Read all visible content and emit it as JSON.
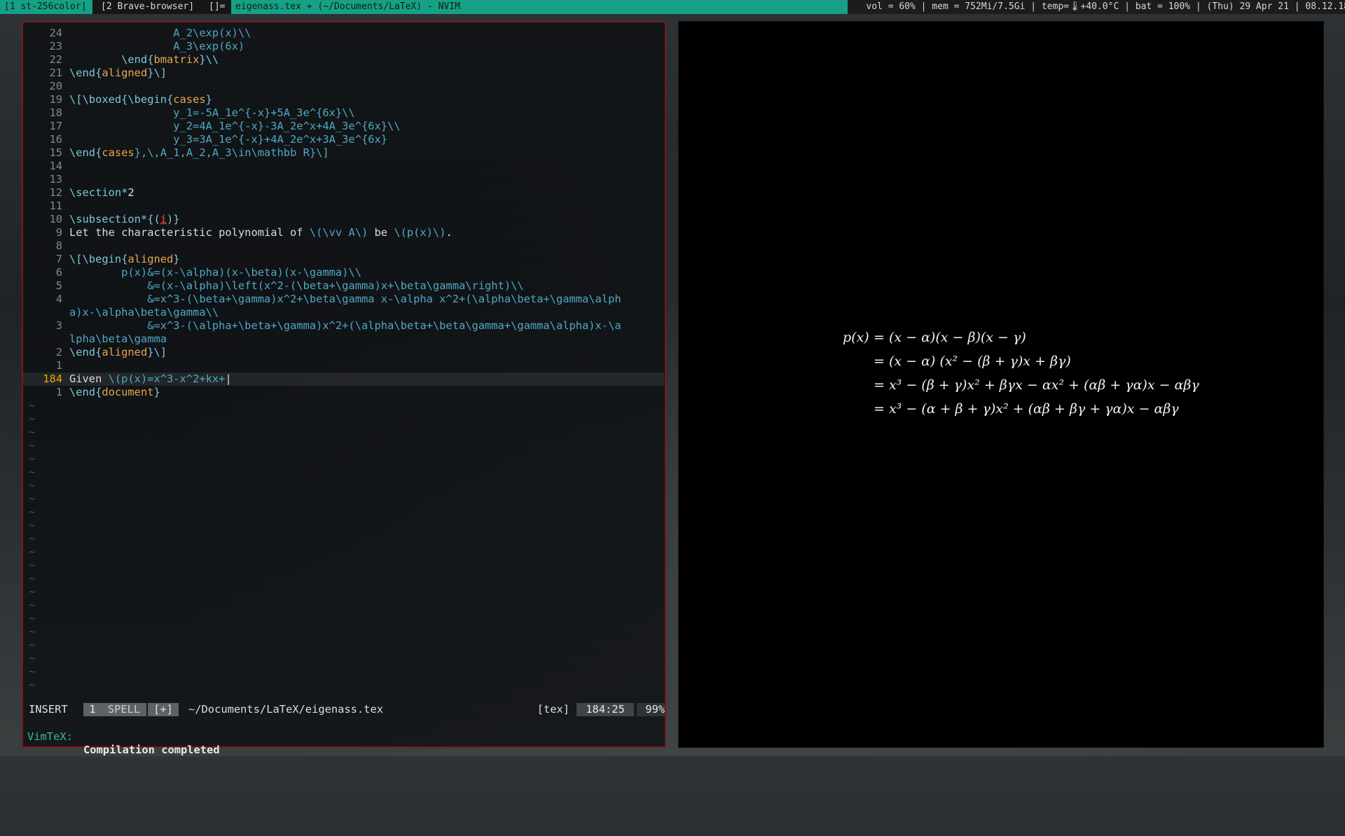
{
  "topbar": {
    "ws1": "[1 st-256color]",
    "ws2": "[2 Brave-browser]",
    "layout": "[]=",
    "window_title": "eigenass.tex + (~/Documents/LaTeX) - NVIM",
    "status": "vol = 60% | mem = 752Mi/7.5Gi | temp=🌡+40.0°C | bat = 100% | (Thu) 29 Apr 21 | 08.12.18"
  },
  "editor": {
    "lines": [
      {
        "n": "24",
        "segs": [
          {
            "t": "                A_2\\exp(x)\\\\",
            "c": "math"
          }
        ]
      },
      {
        "n": "23",
        "segs": [
          {
            "t": "                A_3\\exp(6x)",
            "c": "math"
          }
        ]
      },
      {
        "n": "22",
        "segs": [
          {
            "t": "        \\end{",
            "c": "cmd"
          },
          {
            "t": "bmatrix",
            "c": "env"
          },
          {
            "t": "}\\\\",
            "c": "cmd"
          }
        ]
      },
      {
        "n": "21",
        "segs": [
          {
            "t": "\\end{",
            "c": "cmd"
          },
          {
            "t": "aligned",
            "c": "env"
          },
          {
            "t": "}\\]",
            "c": "cmd"
          }
        ]
      },
      {
        "n": "20",
        "segs": []
      },
      {
        "n": "19",
        "segs": [
          {
            "t": "\\[\\boxed{\\begin{",
            "c": "cmd"
          },
          {
            "t": "cases",
            "c": "env"
          },
          {
            "t": "}",
            "c": "cmd"
          }
        ]
      },
      {
        "n": "18",
        "segs": [
          {
            "t": "                y_1=-5A_1e^{-x}+5A_3e^{6x}\\\\",
            "c": "math"
          }
        ]
      },
      {
        "n": "17",
        "segs": [
          {
            "t": "                y_2=4A_1e^{-x}-3A_2e^x+4A_3e^{6x}\\\\",
            "c": "math"
          }
        ]
      },
      {
        "n": "16",
        "segs": [
          {
            "t": "                y_3=3A_1e^{-x}+4A_2e^x+3A_3e^{6x}",
            "c": "math"
          }
        ]
      },
      {
        "n": "15",
        "segs": [
          {
            "t": "\\end{",
            "c": "cmd"
          },
          {
            "t": "cases",
            "c": "env"
          },
          {
            "t": "},\\,A_1,A_2,A_3\\in\\mathbb R}\\]",
            "c": "math"
          }
        ]
      },
      {
        "n": "14",
        "segs": []
      },
      {
        "n": "13",
        "segs": []
      },
      {
        "n": "12",
        "segs": [
          {
            "t": "\\section*",
            "c": "cmd"
          },
          {
            "t": "2",
            "c": "plain"
          }
        ]
      },
      {
        "n": "11",
        "segs": []
      },
      {
        "n": "10",
        "segs": [
          {
            "t": "\\subsection*{(",
            "c": "cmd"
          },
          {
            "t": "i",
            "c": "err"
          },
          {
            "t": ")}",
            "c": "cmd"
          }
        ]
      },
      {
        "n": "9",
        "segs": [
          {
            "t": "Let the characteristic polynomial of ",
            "c": "plain"
          },
          {
            "t": "\\(\\vv A\\)",
            "c": "math"
          },
          {
            "t": " be ",
            "c": "plain"
          },
          {
            "t": "\\(p(x)\\)",
            "c": "math"
          },
          {
            "t": ".",
            "c": "plain"
          }
        ]
      },
      {
        "n": "8",
        "segs": []
      },
      {
        "n": "7",
        "segs": [
          {
            "t": "\\[\\begin{",
            "c": "cmd"
          },
          {
            "t": "aligned",
            "c": "env"
          },
          {
            "t": "}",
            "c": "cmd"
          }
        ]
      },
      {
        "n": "6",
        "segs": [
          {
            "t": "        p(x)&=(x-\\alpha)(x-\\beta)(x-\\gamma)\\\\",
            "c": "math"
          }
        ]
      },
      {
        "n": "5",
        "segs": [
          {
            "t": "            &=(x-\\alpha)\\left(x^2-(\\beta+\\gamma)x+\\beta\\gamma\\right)\\\\",
            "c": "math"
          }
        ]
      },
      {
        "n": "4",
        "segs": [
          {
            "t": "            &=x^3-(\\beta+\\gamma)x^2+\\beta\\gamma x-\\alpha x^2+(\\alpha\\beta+\\gamma\\alph",
            "c": "math"
          }
        ]
      },
      {
        "n": "",
        "segs": [
          {
            "t": "a)x-\\alpha\\beta\\gamma\\\\",
            "c": "math"
          }
        ]
      },
      {
        "n": "3",
        "segs": [
          {
            "t": "            &=x^3-(\\alpha+\\beta+\\gamma)x^2+(\\alpha\\beta+\\beta\\gamma+\\gamma\\alpha)x-\\a",
            "c": "math"
          }
        ]
      },
      {
        "n": "",
        "segs": [
          {
            "t": "lpha\\beta\\gamma",
            "c": "math"
          }
        ]
      },
      {
        "n": "2",
        "segs": [
          {
            "t": "\\end{",
            "c": "cmd"
          },
          {
            "t": "aligned",
            "c": "env"
          },
          {
            "t": "}\\]",
            "c": "cmd"
          }
        ]
      },
      {
        "n": "1",
        "segs": []
      },
      {
        "n": "184",
        "cur": true,
        "segs": [
          {
            "t": "Given ",
            "c": "plain"
          },
          {
            "t": "\\(p(x)=x^3-x^2+kx+",
            "c": "math"
          },
          {
            "t": "|",
            "c": "plain"
          }
        ]
      },
      {
        "n": "1",
        "segs": [
          {
            "t": "\\end{",
            "c": "cmd"
          },
          {
            "t": "document",
            "c": "env"
          },
          {
            "t": "}",
            "c": "cmd"
          }
        ]
      }
    ],
    "tilde_glyph": "~",
    "statusline": {
      "mode": "INSERT",
      "bufnum": "1",
      "spell": "SPELL",
      "modified": "[+]",
      "filepath": "~/Documents/LaTeX/eigenass.tex",
      "filetype": "[tex]",
      "position": "184:25",
      "percent": "99%"
    },
    "cmdline": {
      "prefix": "VimTeX:",
      "message": "Compilation completed"
    }
  },
  "preview": {
    "lines": [
      {
        "lhs": "p(x)",
        "rhs": "= (x − α)(x − β)(x − γ)"
      },
      {
        "lhs": "",
        "rhs": "= (x − α) (x² − (β + γ)x + βγ)"
      },
      {
        "lhs": "",
        "rhs": "= x³ − (β + γ)x² + βγx − αx² + (αβ + γα)x − αβγ"
      },
      {
        "lhs": "",
        "rhs": "= x³ − (α + β + γ)x² + (αβ + βγ + γα)x − αβγ"
      }
    ]
  }
}
